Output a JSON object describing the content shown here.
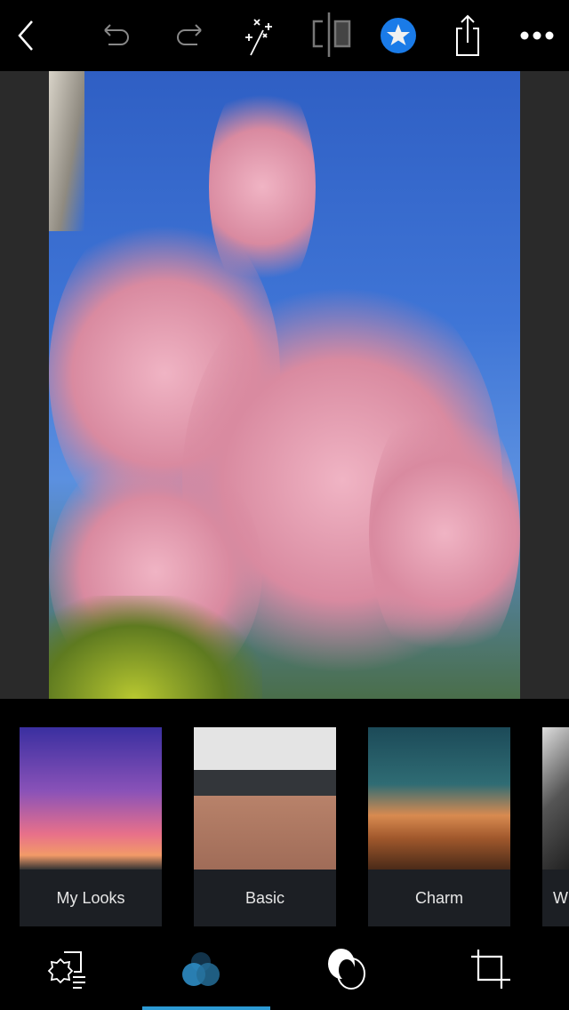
{
  "toolbar": {
    "icons": [
      "chevron-left-icon",
      "undo-icon",
      "redo-icon",
      "magic-wand-icon",
      "compare-icon",
      "favorite-star-icon",
      "share-icon",
      "more-icon"
    ],
    "accent": "#1a7be8"
  },
  "looks": [
    {
      "label": "My Looks"
    },
    {
      "label": "Basic"
    },
    {
      "label": "Charm"
    },
    {
      "label": "W"
    }
  ],
  "bottom_tabs": {
    "icons": [
      "adjustments-icon",
      "looks-icon",
      "blend-icon",
      "crop-icon"
    ],
    "active": 1,
    "active_color": "#2d9ad4"
  }
}
